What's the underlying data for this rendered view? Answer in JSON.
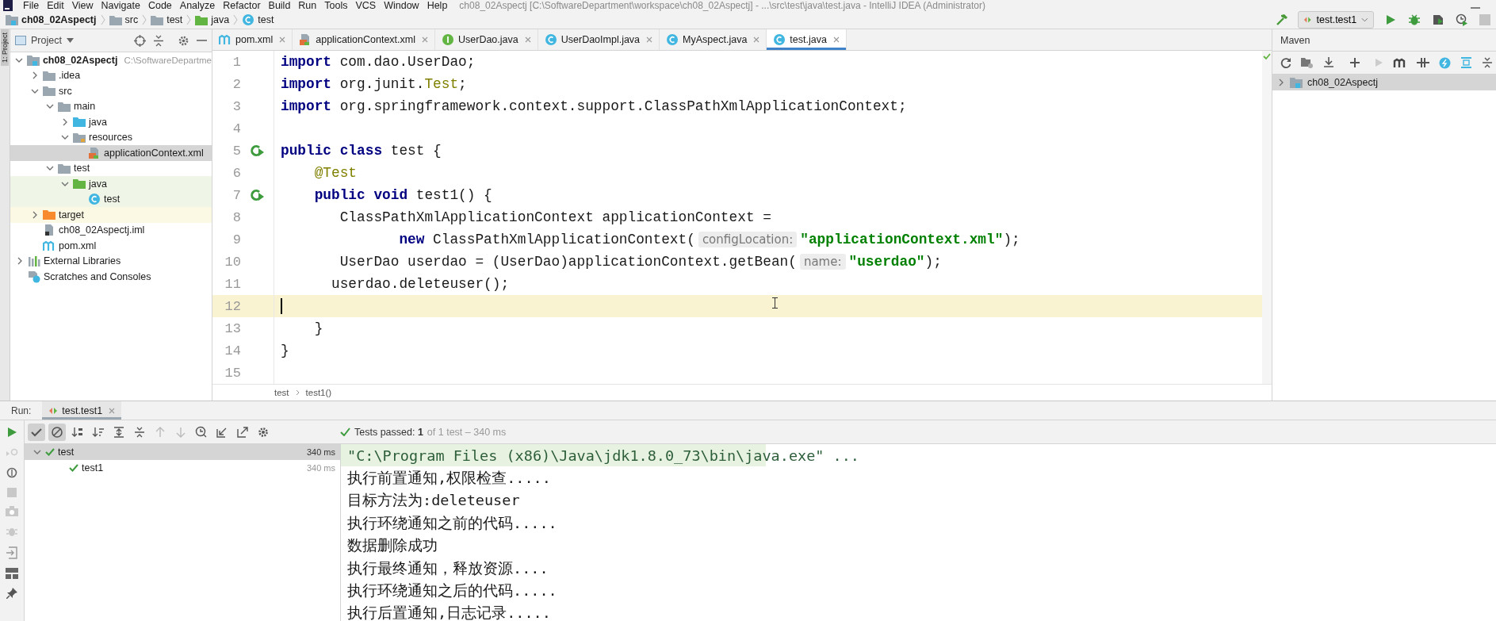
{
  "menu": [
    "File",
    "Edit",
    "View",
    "Navigate",
    "Code",
    "Analyze",
    "Refactor",
    "Build",
    "Run",
    "Tools",
    "VCS",
    "Window",
    "Help"
  ],
  "window_title": "ch08_02Aspectj [C:\\SoftwareDepartment\\workspace\\ch08_02Aspectj] - ...\\src\\test\\java\\test.java - IntelliJ IDEA (Administrator)",
  "breadcrumb": [
    {
      "label": "ch08_02Aspectj",
      "kind": "module"
    },
    {
      "label": "src",
      "kind": "folder"
    },
    {
      "label": "test",
      "kind": "folder"
    },
    {
      "label": "java",
      "kind": "test-folder"
    },
    {
      "label": "test",
      "kind": "class"
    }
  ],
  "run_config": "test.test1",
  "project_panel": {
    "title": "Project",
    "side_tab": "1: Project",
    "tree": [
      {
        "label": "ch08_02Aspectj",
        "path": "C:\\SoftwareDepartme",
        "kind": "module",
        "expanded": true,
        "selected": false,
        "children": [
          {
            "label": ".idea",
            "kind": "folder",
            "expanded": false,
            "selected": false
          },
          {
            "label": "src",
            "kind": "folder",
            "expanded": true,
            "selected": false,
            "children": [
              {
                "label": "main",
                "kind": "folder",
                "expanded": true,
                "selected": false,
                "children": [
                  {
                    "label": "java",
                    "kind": "source-folder",
                    "expanded": false,
                    "selected": false
                  },
                  {
                    "label": "resources",
                    "kind": "resources-folder",
                    "expanded": true,
                    "selected": false,
                    "children": [
                      {
                        "label": "applicationContext.xml",
                        "kind": "xml",
                        "selected": true
                      }
                    ]
                  }
                ]
              },
              {
                "label": "test",
                "kind": "folder",
                "expanded": true,
                "selected": false,
                "children": [
                  {
                    "label": "java",
                    "kind": "test-folder",
                    "expanded": true,
                    "selected": false,
                    "children": [
                      {
                        "label": "test",
                        "kind": "class",
                        "selected": false
                      }
                    ]
                  }
                ]
              }
            ]
          },
          {
            "label": "target",
            "kind": "excluded-folder",
            "expanded": false,
            "selected": false
          },
          {
            "label": "ch08_02Aspectj.iml",
            "kind": "iml",
            "selected": false
          },
          {
            "label": "pom.xml",
            "kind": "maven",
            "selected": false
          }
        ]
      },
      {
        "label": "External Libraries",
        "kind": "libraries",
        "expanded": false,
        "selected": false
      },
      {
        "label": "Scratches and Consoles",
        "kind": "scratches",
        "selected": false
      }
    ]
  },
  "tabs": [
    {
      "label": "pom.xml",
      "kind": "maven",
      "selected": false
    },
    {
      "label": "applicationContext.xml",
      "kind": "xml",
      "selected": false
    },
    {
      "label": "UserDao.java",
      "kind": "interface",
      "selected": false
    },
    {
      "label": "UserDaoImpl.java",
      "kind": "class",
      "selected": false
    },
    {
      "label": "MyAspect.java",
      "kind": "class",
      "selected": false
    },
    {
      "label": "test.java",
      "kind": "class",
      "selected": true
    }
  ],
  "code": [
    {
      "number": "1",
      "run_marker": false,
      "current": false,
      "tokens": [
        {
          "kind": "keyword",
          "text": "import"
        },
        {
          "kind": "plain",
          "text": " com.dao.UserDao;"
        }
      ]
    },
    {
      "number": "2",
      "run_marker": false,
      "current": false,
      "tokens": [
        {
          "kind": "keyword",
          "text": "import"
        },
        {
          "kind": "plain",
          "text": " org.junit."
        },
        {
          "kind": "annotation",
          "text": "Test"
        },
        {
          "kind": "plain",
          "text": ";"
        }
      ]
    },
    {
      "number": "3",
      "run_marker": false,
      "current": false,
      "tokens": [
        {
          "kind": "keyword",
          "text": "import"
        },
        {
          "kind": "plain",
          "text": " org.springframework.context.support.ClassPathXmlApplicationContext;"
        }
      ]
    },
    {
      "number": "4",
      "run_marker": false,
      "current": false
    },
    {
      "number": "5",
      "run_marker": true,
      "current": false,
      "tokens": [
        {
          "kind": "keyword",
          "text": "public class"
        },
        {
          "kind": "plain",
          "text": " test {"
        }
      ]
    },
    {
      "number": "6",
      "run_marker": false,
      "current": false,
      "tokens": [
        {
          "kind": "annotation",
          "text": "    @Test"
        }
      ]
    },
    {
      "number": "7",
      "run_marker": true,
      "current": false,
      "tokens": [
        {
          "kind": "keyword",
          "text": "    public void"
        },
        {
          "kind": "plain",
          "text": " test1() {"
        }
      ]
    },
    {
      "number": "8",
      "run_marker": false,
      "current": false,
      "tokens": [
        {
          "kind": "plain",
          "text": "       ClassPathXmlApplicationContext applicationContext ="
        }
      ]
    },
    {
      "number": "9",
      "run_marker": false,
      "current": false,
      "tokens": [
        {
          "kind": "keyword",
          "text": "              new"
        },
        {
          "kind": "plain",
          "text": " ClassPathXmlApplicationContext("
        },
        {
          "kind": "hint",
          "text": "configLocation:"
        },
        {
          "kind": "string",
          "text": "\"applicationContext.xml\""
        },
        {
          "kind": "plain",
          "text": ");"
        }
      ]
    },
    {
      "number": "10",
      "run_marker": false,
      "current": false,
      "tokens": [
        {
          "kind": "plain",
          "text": "       UserDao userdao = (UserDao)applicationContext.getBean("
        },
        {
          "kind": "hint",
          "text": "name:"
        },
        {
          "kind": "string",
          "text": "\"userdao\""
        },
        {
          "kind": "plain",
          "text": ");"
        }
      ]
    },
    {
      "number": "11",
      "run_marker": false,
      "current": false,
      "tokens": [
        {
          "kind": "plain",
          "text": "      userdao.deleteuser();"
        }
      ]
    },
    {
      "number": "12",
      "run_marker": false,
      "current": true
    },
    {
      "number": "13",
      "run_marker": false,
      "current": false,
      "tokens": [
        {
          "kind": "plain",
          "text": "    }"
        }
      ]
    },
    {
      "number": "14",
      "run_marker": false,
      "current": false,
      "tokens": [
        {
          "kind": "plain",
          "text": "}"
        }
      ]
    },
    {
      "number": "15",
      "run_marker": false,
      "current": false
    }
  ],
  "editor_breadcrumb": [
    "test",
    "test1()"
  ],
  "maven": {
    "title": "Maven",
    "tree": [
      {
        "label": "ch08_02Aspectj",
        "expanded": false,
        "selected": true
      }
    ]
  },
  "run_panel": {
    "label": "Run:",
    "tab": "test.test1",
    "toolbar": [
      {
        "kind": "show-passed",
        "pressed": true
      },
      {
        "kind": "show-ignored",
        "pressed": true
      },
      {
        "kind": "sort-alpha",
        "pressed": false
      },
      {
        "kind": "sort-duration",
        "pressed": false
      },
      {
        "kind": "expand-all",
        "pressed": false
      },
      {
        "kind": "collapse-all",
        "pressed": false
      },
      {
        "kind": "previous",
        "pressed": false
      },
      {
        "kind": "next",
        "pressed": false
      },
      {
        "kind": "history",
        "pressed": false
      },
      {
        "kind": "import",
        "pressed": false
      },
      {
        "kind": "export",
        "pressed": false
      },
      {
        "kind": "settings",
        "pressed": false
      }
    ],
    "status": "Tests passed: **1**",
    "status_detail": "of 1 test – 340 ms",
    "tests": [
      {
        "label": "test",
        "time": "340 ms",
        "selected": true,
        "expanded": true,
        "children": [
          {
            "label": "test1",
            "time": "340 ms",
            "selected": false
          }
        ]
      }
    ],
    "console": [
      {
        "kind": "command",
        "text": "\"C:\\Program Files (x86)\\Java\\jdk1.8.0_73\\bin\\java.exe\" ..."
      },
      {
        "kind": "output",
        "text": "执行前置通知,权限检查....."
      },
      {
        "kind": "output",
        "text": "目标方法为:deleteuser"
      },
      {
        "kind": "output",
        "text": "执行环绕通知之前的代码....."
      },
      {
        "kind": "output",
        "text": "数据删除成功"
      },
      {
        "kind": "output",
        "text": "执行最终通知，释放资源...."
      },
      {
        "kind": "output",
        "text": "执行环绕通知之后的代码....."
      },
      {
        "kind": "output",
        "text": "执行后置通知,日志记录....."
      }
    ]
  }
}
